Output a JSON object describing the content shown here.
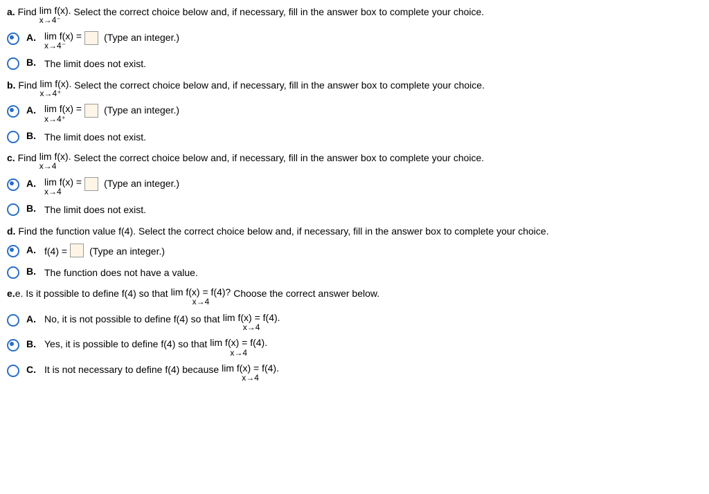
{
  "qa": {
    "prompt_pre": "a.",
    "prompt_text1": " Find ",
    "lim_top": "lim  f(x).",
    "lim_bot": "x→4⁻",
    "prompt_text2": " Select the correct choice below and, if necessary, fill in the answer box to complete your choice.",
    "A_lim_top": "lim  f(x) =",
    "A_lim_bot": "x→4⁻",
    "A_hint": "(Type an integer.)",
    "B_text": "The limit does not exist."
  },
  "qb": {
    "prompt_pre": "b.",
    "prompt_text1": " Find ",
    "lim_top": "lim  f(x).",
    "lim_bot": "x→4⁺",
    "prompt_text2": " Select the correct choice below and, if necessary, fill in the answer box to complete your choice.",
    "A_lim_top": "lim  f(x) =",
    "A_lim_bot": "x→4⁺",
    "A_hint": "(Type an integer.)",
    "B_text": "The limit does not exist."
  },
  "qc": {
    "prompt_pre": "c.",
    "prompt_text1": " Find ",
    "lim_top": "lim  f(x).",
    "lim_bot": "x→4",
    "prompt_text2": " Select the correct choice below and, if necessary, fill in the answer box to complete your choice.",
    "A_lim_top": "lim  f(x) =",
    "A_lim_bot": "x→4",
    "A_hint": "(Type an integer.)",
    "B_text": "The limit does not exist."
  },
  "qd": {
    "prompt": "d. Find the function value f(4). Select the correct choice below and, if necessary, fill in the answer box to complete your choice.",
    "A_text": "f(4) =",
    "A_hint": "(Type an integer.)",
    "B_text": "The function does not have a value."
  },
  "qe": {
    "prompt1": "e. Is it possible to define f(4) so that ",
    "prompt_lim_top": "lim  f(x) = f(4)?",
    "prompt_lim_bot": "x→4",
    "prompt2": " Choose the correct answer below.",
    "A_text1": "No, it is not possible to define f(4) so that ",
    "A_lim_top": "lim  f(x) = f(4).",
    "A_lim_bot": "x→4",
    "B_text1": "Yes, it is possible to define f(4) so that ",
    "B_lim_top": "lim  f(x) = f(4).",
    "B_lim_bot": "x→4",
    "C_text1": "It is not necessary to define f(4) because ",
    "C_lim_top": "lim  f(x) = f(4).",
    "C_lim_bot": "x→4"
  },
  "labels": {
    "A": "A.",
    "B": "B.",
    "C": "C."
  }
}
